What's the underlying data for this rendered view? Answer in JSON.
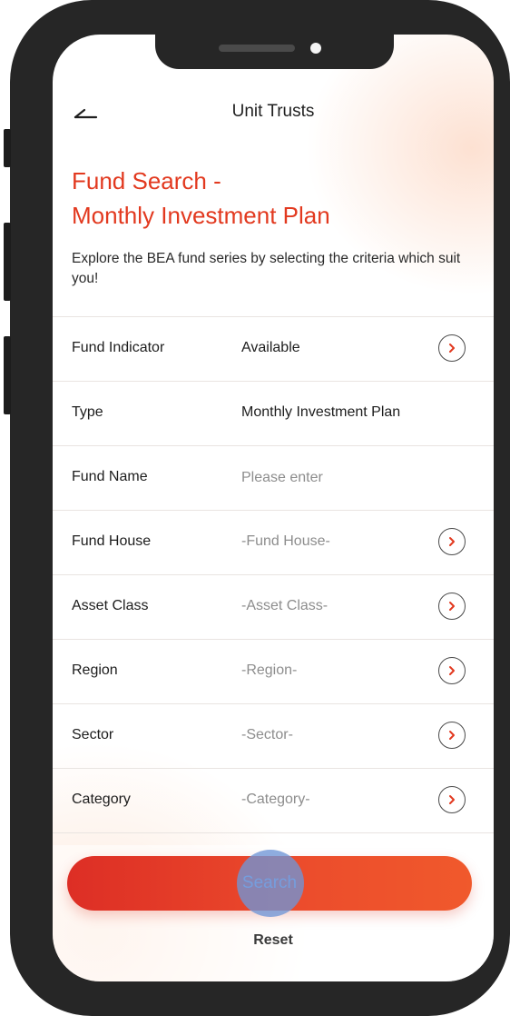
{
  "header": {
    "title": "Unit Trusts",
    "back_icon": "back-arrow-icon"
  },
  "headline": {
    "line1": "Fund Search -",
    "line2": "Monthly Investment Plan"
  },
  "intro": "Explore the BEA fund series by selecting the criteria which suit you!",
  "criteria": [
    {
      "label": "Fund Indicator",
      "value": "Available",
      "selector": true
    },
    {
      "label": "Type",
      "value": "Monthly Investment Plan",
      "selector": false
    },
    {
      "label": "Fund Name",
      "placeholder": "Please enter",
      "input": true
    },
    {
      "label": "Fund House",
      "value": "-Fund House-",
      "selector": true
    },
    {
      "label": "Asset Class",
      "value": "-Asset Class-",
      "selector": true
    },
    {
      "label": "Region",
      "value": "-Region-",
      "selector": true
    },
    {
      "label": "Sector",
      "value": "-Sector-",
      "selector": true
    },
    {
      "label": "Category",
      "value": "-Category-",
      "selector": true
    }
  ],
  "actions": {
    "search_label": "Search",
    "reset_label": "Reset"
  },
  "colors": {
    "accent": "#e2391f",
    "button_gradient_start": "#dd2e25",
    "button_gradient_end": "#f0592c",
    "frame": "#262626"
  }
}
